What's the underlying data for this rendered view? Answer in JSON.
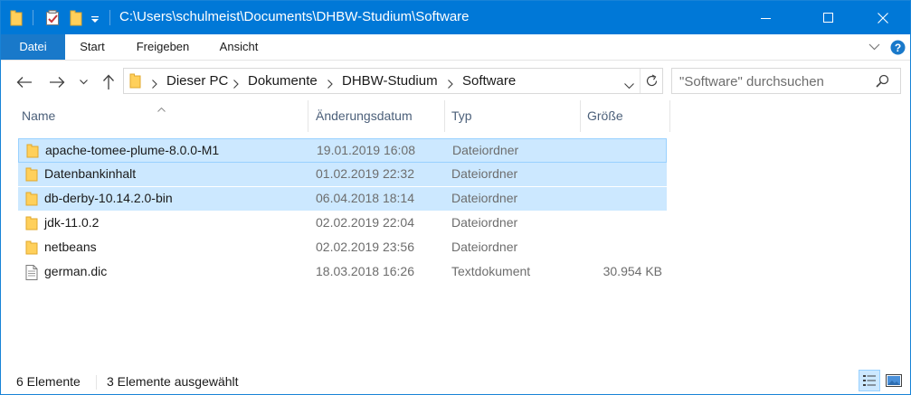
{
  "window": {
    "title": "C:\\Users\\schulmeist\\Documents\\DHBW-Studium\\Software"
  },
  "ribbon": {
    "tabs": [
      {
        "label": "Datei"
      },
      {
        "label": "Start"
      },
      {
        "label": "Freigeben"
      },
      {
        "label": "Ansicht"
      }
    ]
  },
  "address": {
    "crumbs": [
      "Dieser PC",
      "Dokumente",
      "DHBW-Studium",
      "Software"
    ]
  },
  "search": {
    "placeholder": "\"Software\" durchsuchen"
  },
  "columns": {
    "name": "Name",
    "date": "Änderungsdatum",
    "type": "Typ",
    "size": "Größe"
  },
  "files": [
    {
      "name": "apache-tomee-plume-8.0.0-M1",
      "date": "19.01.2019 16:08",
      "type": "Dateiordner",
      "size": "",
      "icon": "folder-icon",
      "selected": true
    },
    {
      "name": "Datenbankinhalt",
      "date": "01.02.2019 22:32",
      "type": "Dateiordner",
      "size": "",
      "icon": "folder-icon",
      "selected": true
    },
    {
      "name": "db-derby-10.14.2.0-bin",
      "date": "06.04.2018 18:14",
      "type": "Dateiordner",
      "size": "",
      "icon": "folder-icon",
      "selected": true
    },
    {
      "name": "jdk-11.0.2",
      "date": "02.02.2019 22:04",
      "type": "Dateiordner",
      "size": "",
      "icon": "folder-icon",
      "selected": false
    },
    {
      "name": "netbeans",
      "date": "02.02.2019 23:56",
      "type": "Dateiordner",
      "size": "",
      "icon": "folder-icon",
      "selected": false
    },
    {
      "name": "german.dic",
      "date": "18.03.2018 16:26",
      "type": "Textdokument",
      "size": "30.954 KB",
      "icon": "text-file-icon",
      "selected": false
    }
  ],
  "status": {
    "count": "6 Elemente",
    "selected": "3 Elemente ausgewählt"
  },
  "colors": {
    "accent": "#0078d7",
    "selection": "#cce8ff",
    "selection_border": "#99d1ff",
    "folder": "#ffd05b"
  }
}
